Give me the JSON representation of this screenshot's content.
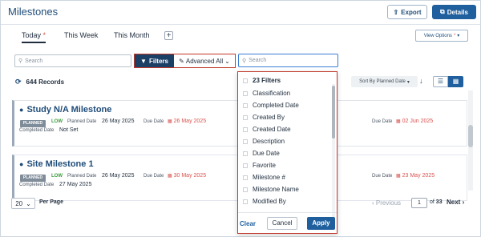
{
  "header": {
    "title": "Milestones",
    "export_label": "Export",
    "details_label": "Details"
  },
  "tabs": {
    "today": "Today",
    "today_star": "*",
    "this_week": "This Week",
    "this_month": "This Month",
    "add": "+"
  },
  "view_options": {
    "label": "View Options",
    "star": "*"
  },
  "filter_bar": {
    "search_placeholder": "Search",
    "filters_label": "Filters",
    "advanced_label": "Advanced All",
    "right_search_placeholder": "Search"
  },
  "records": {
    "count_label": "644 Records",
    "sort_label": "Sort By Planned Date"
  },
  "cards": [
    {
      "title": "Study N/A Milestone",
      "status": "PLANNED",
      "priority": "LOW",
      "planned_date_label": "Planned Date",
      "planned_date": "26 May 2025",
      "due_date_label_1": "Due Date",
      "due_date_1": "26 May 2025",
      "due_date_label_2": "Due Date",
      "due_date_2": "02 Jun 2025",
      "completed_date_label": "Completed Date",
      "completed_date": "Not Set"
    },
    {
      "title": "Site Milestone 1",
      "status": "PLANNED",
      "priority": "LOW",
      "planned_date_label": "Planned Date",
      "planned_date": "26 May 2025",
      "due_date_label_1": "Due Date",
      "due_date_1": "30 May 2025",
      "due_date_label_2": "Due Date",
      "due_date_2": "23 May 2025",
      "completed_date_label": "Completed Date",
      "completed_date": "27 May 2025"
    }
  ],
  "pagination": {
    "per_page_value": "20",
    "per_page_label": "Per Page",
    "previous": "Previous",
    "current_page": "1",
    "of_label": "of",
    "total_pages": "33",
    "next": "Next"
  },
  "filters_dropdown": {
    "header": "23  Filters",
    "items": [
      "Classification",
      "Completed Date",
      "Created By",
      "Created Date",
      "Description",
      "Due Date",
      "Favorite",
      "Milestone #",
      "Milestone Name",
      "Modified By"
    ],
    "clear": "Clear",
    "cancel": "Cancel",
    "apply": "Apply"
  },
  "icons": {
    "export": "upload-icon",
    "details": "external-link-icon",
    "filter": "funnel-icon",
    "advanced": "pencil-icon",
    "search": "search-icon",
    "refresh": "refresh-icon",
    "pin": "location-pin-icon",
    "calendar": "calendar-icon"
  },
  "colors": {
    "primary": "#1f5f9e",
    "filters_button": "#1c3f66",
    "overdue": "#d9534f",
    "priority_low": "#3a9a3a",
    "highlight_border": "#c0392b"
  }
}
